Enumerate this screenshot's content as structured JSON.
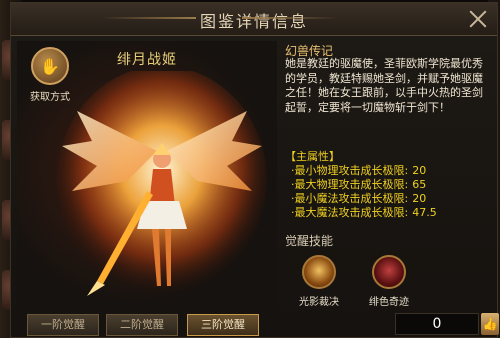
{
  "window": {
    "title": "图鉴详情信息"
  },
  "character": {
    "name": "绯月战姬",
    "acquire_label": "获取方式"
  },
  "lore": {
    "heading": "幻兽传记",
    "text": "她是教廷的驱魔使，圣菲欧斯学院最优秀的学员，教廷特赐她圣剑，并赋予她驱魔之任！她在女王跟前，以手中火热的圣剑起誓，定要将一切魔物斩于剑下！"
  },
  "attributes": {
    "heading": "【主属性】",
    "rows": [
      {
        "label": "·最小物理攻击成长极限:",
        "value": "20"
      },
      {
        "label": "·最大物理攻击成长极限:",
        "value": "65"
      },
      {
        "label": "·最小魔法攻击成长极限:",
        "value": "20"
      },
      {
        "label": "·最大魔法攻击成长极限:",
        "value": "47.5"
      }
    ]
  },
  "awakening": {
    "heading": "觉醒技能",
    "skills": [
      {
        "name": "光影裁决",
        "icon": "blade-icon"
      },
      {
        "name": "绯色奇迹",
        "icon": "shield-icon"
      }
    ]
  },
  "tiers": [
    "一阶觉醒",
    "二阶觉醒",
    "三阶觉醒"
  ],
  "likes": {
    "count": "0"
  },
  "colors": {
    "attribute": "#f0d020",
    "name": "#e8d07a",
    "lore_heading": "#e8c070"
  }
}
